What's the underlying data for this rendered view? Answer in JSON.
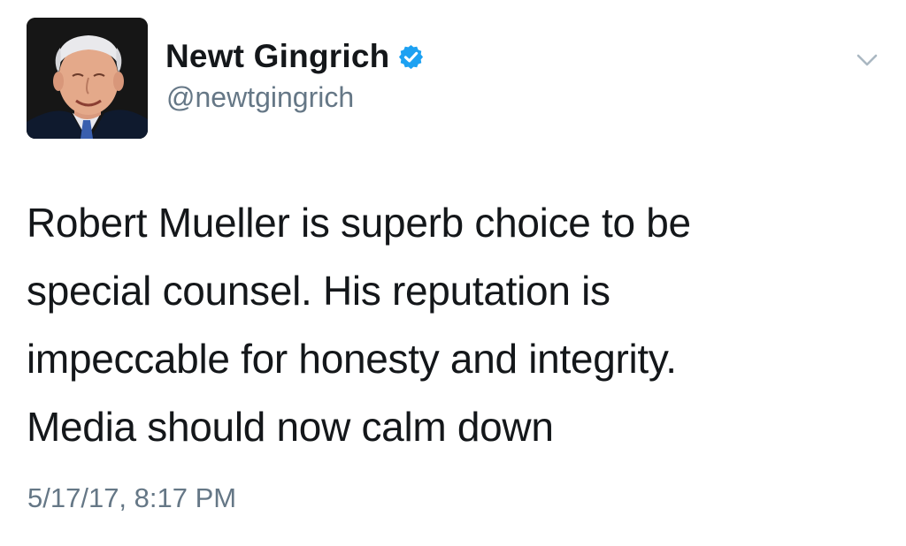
{
  "author": {
    "display_name": "Newt Gingrich",
    "handle": "@newtgingrich",
    "verified": true,
    "avatar_icon": "profile-photo",
    "verified_icon": "verified-badge-icon",
    "verified_color": "#1da1f2"
  },
  "menu": {
    "icon": "chevron-down-icon"
  },
  "tweet": {
    "lines": [
      "Robert Mueller is superb choice to be",
      "special counsel. His reputation is",
      "impeccable for honesty and integrity.",
      "Media should now calm down"
    ],
    "timestamp": "5/17/17, 8:17 PM"
  },
  "colors": {
    "text": "#14171a",
    "secondary": "#657786",
    "background": "#ffffff"
  }
}
